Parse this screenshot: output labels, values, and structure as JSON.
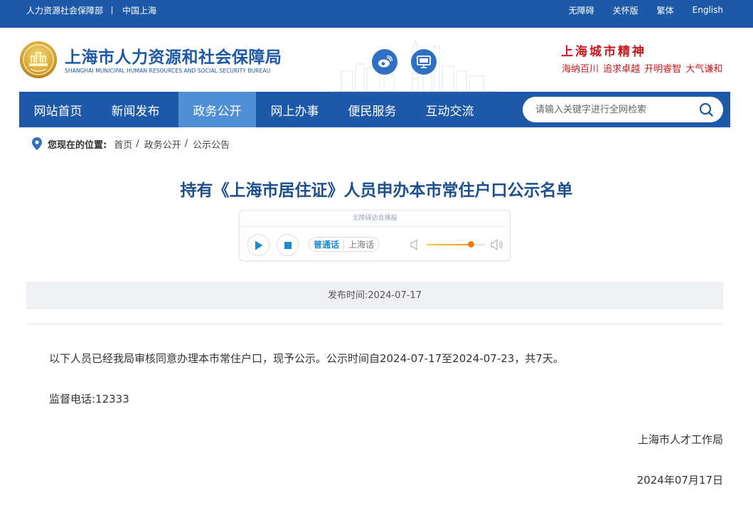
{
  "topbar": {
    "links_left": [
      "人力资源社会保障部",
      "中国上海"
    ],
    "links_right": [
      "无障碍",
      "关怀版",
      "繁体",
      "English"
    ]
  },
  "header": {
    "logo_cn": "上海市人力资源和社会保障局",
    "logo_en": "SHANGHAI MUNICIPAL HUMAN RESOURCES AND SOCIAL SECURITY BUREAU",
    "spirit_title": "上海城市精神",
    "spirit_sub": "海纳百川 追求卓越 开明睿智 大气谦和",
    "social_icons": [
      "weibo-icon",
      "monitor-icon"
    ]
  },
  "nav": {
    "items": [
      "网站首页",
      "新闻发布",
      "政务公开",
      "网上办事",
      "便民服务",
      "互动交流"
    ],
    "active_index": 2,
    "search_placeholder": "请输入关键字进行全网检索"
  },
  "breadcrumb": {
    "label": "您现在的位置:",
    "items": [
      "首页",
      "政务公开",
      "公示公告"
    ]
  },
  "article": {
    "title": "持有《上海市居住证》人员申办本市常住户口公示名单",
    "publish_time": "发布时间:2024-07-17",
    "paragraph1": "以下人员已经我局审核同意办理本市常住户口，现予公示。公示时间自2024-07-17至2024-07-23，共7天。",
    "paragraph2": "监督电话:12333",
    "signature": "上海市人才工作局",
    "date": "2024年07月17日"
  },
  "player": {
    "caption": "无障碍语音播报",
    "lang_active": "普通话",
    "lang_other": "上海话",
    "volume_fraction": 0.76
  },
  "colors": {
    "brand_blue": "#1d59a8",
    "nav_active": "#4f8fd6",
    "title_blue": "#1d4f8f",
    "spirit_red": "#c8171e"
  }
}
